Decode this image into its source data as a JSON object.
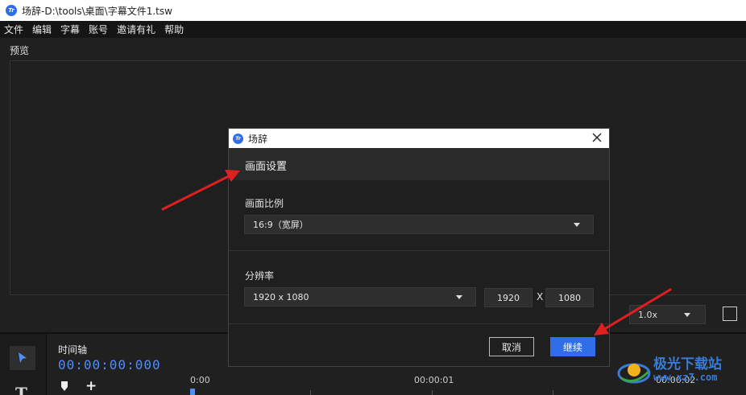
{
  "window": {
    "title": "场辞-D:\\tools\\桌面\\字幕文件1.tsw",
    "logo_text": "Tr"
  },
  "menu": {
    "items": [
      "文件",
      "编辑",
      "字幕",
      "账号",
      "邀请有礼",
      "帮助"
    ]
  },
  "preview": {
    "label": "预览",
    "speed": "1.0x"
  },
  "timeline": {
    "label": "时间轴",
    "timecode": "00:00:00:000",
    "ticks": [
      "0:00",
      "00:00:01",
      "00:00:02"
    ]
  },
  "dialog": {
    "title": "场辞",
    "logo_text": "Tr",
    "section_title": "画面设置",
    "aspect_label": "画面比例",
    "aspect_value": "16:9（宽屏）",
    "resolution_label": "分辨率",
    "resolution_value": "1920 x 1080",
    "width_value": "1920",
    "separator": "X",
    "height_value": "1080",
    "cancel_label": "取消",
    "continue_label": "继续"
  },
  "watermark": {
    "text": "极光下载站",
    "url": "www.xz7.com"
  },
  "colors": {
    "accent": "#2f6ee8",
    "timecode": "#4d8ef7",
    "annotation": "#e02020"
  }
}
